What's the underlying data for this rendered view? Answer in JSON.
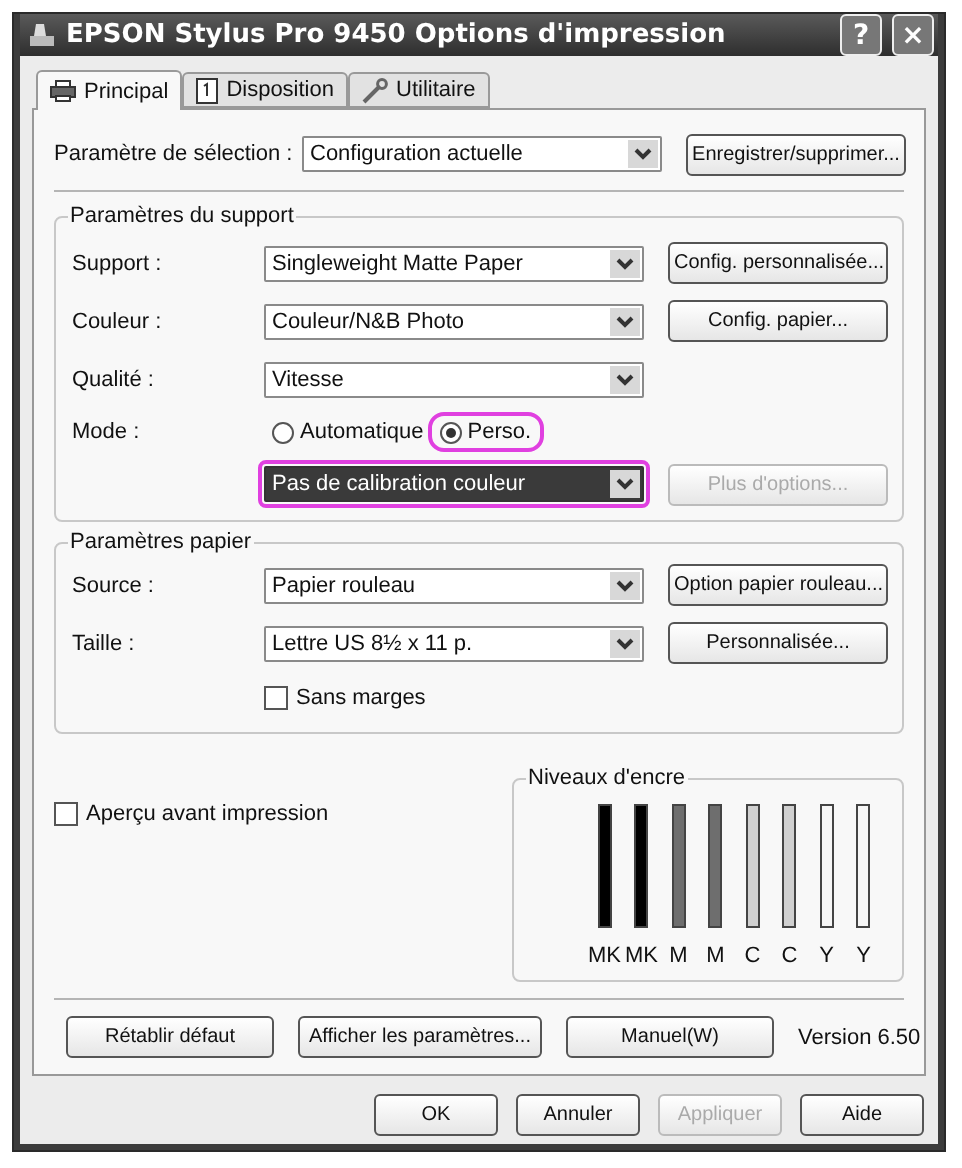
{
  "window": {
    "title": "EPSON Stylus Pro 9450 Options d'impression",
    "buttons": [
      "?",
      "×"
    ]
  },
  "tabs": [
    {
      "label": "Principal",
      "selected": true
    },
    {
      "label": "Disposition",
      "selected": false
    },
    {
      "label": "Utilitaire",
      "selected": false
    }
  ],
  "selection": {
    "label": "Paramètre de sélection :",
    "value": "Configuration actuelle",
    "button": "Enregistrer/supprimer..."
  },
  "media_group": {
    "title": "Paramètres du support",
    "rows": [
      {
        "label": "Support :",
        "value": "Singleweight Matte Paper",
        "button": "Config. personnalisée..."
      },
      {
        "label": "Couleur :",
        "value": "Couleur/N&B Photo",
        "button": "Config. papier..."
      },
      {
        "label": "Qualité :",
        "value": "Vitesse"
      }
    ],
    "mode": {
      "label": "Mode :",
      "options": [
        {
          "label": "Automatique",
          "selected": false,
          "highlighted": false
        },
        {
          "label": "Perso.",
          "selected": true,
          "highlighted": true
        }
      ],
      "dropdown": {
        "value": "Pas de calibration couleur",
        "focused": true,
        "highlighted": true
      },
      "button": {
        "label": "Plus d'options...",
        "disabled": true
      }
    }
  },
  "paper_group": {
    "title": "Paramètres papier",
    "rows": [
      {
        "label": "Source :",
        "value": "Papier rouleau",
        "button": "Option papier rouleau..."
      },
      {
        "label": "Taille :",
        "value": "Lettre US 8½ x 11 p.",
        "button": "Personnalisée..."
      }
    ],
    "borderless": {
      "label": "Sans marges",
      "checked": false
    }
  },
  "preview": {
    "label": "Aperçu avant impression",
    "checked": false
  },
  "ink": {
    "title": "Niveaux d'encre",
    "inks": [
      {
        "label": "MK",
        "color": "#000000"
      },
      {
        "label": "MK",
        "color": "#000000"
      },
      {
        "label": "M",
        "color": "#6e6e6e"
      },
      {
        "label": "M",
        "color": "#6e6e6e"
      },
      {
        "label": "C",
        "color": "#d0d0d0"
      },
      {
        "label": "C",
        "color": "#d0d0d0"
      },
      {
        "label": "Y",
        "color": "#f6f6f6"
      },
      {
        "label": "Y",
        "color": "#f6f6f6"
      }
    ]
  },
  "actions": [
    {
      "label": "Rétablir défaut"
    },
    {
      "label": "Afficher les paramètres..."
    },
    {
      "label": "Manuel(W)"
    }
  ],
  "version": "Version 6.50",
  "footer": [
    {
      "label": "OK",
      "disabled": false
    },
    {
      "label": "Annuler",
      "disabled": false
    },
    {
      "label": "Appliquer",
      "disabled": true
    },
    {
      "label": "Aide",
      "disabled": false
    }
  ]
}
